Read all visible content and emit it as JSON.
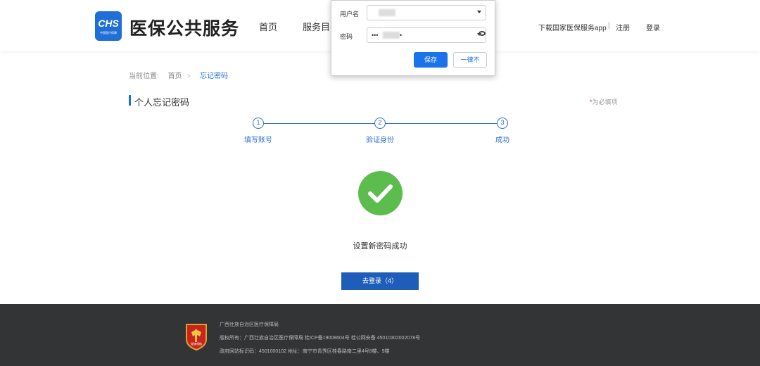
{
  "header": {
    "logo_text": "CHS",
    "logo_subtext": "中国医疗保障",
    "site_title": "医保公共服务",
    "nav": {
      "home": "首页",
      "catalog": "服务目录"
    },
    "download_app": "下载国家医保服务app",
    "separator": "|",
    "register": "注册",
    "login": "登录"
  },
  "password_popup": {
    "username_label": "用户名",
    "password_label": "密码",
    "password_value": "•••",
    "password_tail": "•",
    "save_label": "保存",
    "never_label": "一律不"
  },
  "breadcrumb": {
    "prefix": "当前位置:",
    "home": "首页",
    "arrow": ">",
    "current": "忘记密码"
  },
  "section": {
    "title": "个人忘记密码",
    "required_star": "*",
    "required_text": "为必填项"
  },
  "steps": [
    {
      "num": "1",
      "label": "填写账号"
    },
    {
      "num": "2",
      "label": "验证身份"
    },
    {
      "num": "3",
      "label": "成功"
    }
  ],
  "result": {
    "message": "设置新密码成功",
    "button_label": "去登录（4）"
  },
  "footer": {
    "emblem_text": "党旗领航",
    "org": "广西壮族自治区医疗保障局",
    "copyright": "版权所有：广西壮族自治区医疗保障局 桂ICP备19008604号 桂公网安备 45010302002078号",
    "site_code_address": "政府网站标识码：4501000102   地址：南宁市青秀区桂春路南二里4号8楼、9楼"
  },
  "colors": {
    "brand_blue": "#1f6fd6",
    "success_green": "#5cbd4e",
    "button_blue": "#1f5eb8",
    "footer_bg": "#333436"
  }
}
